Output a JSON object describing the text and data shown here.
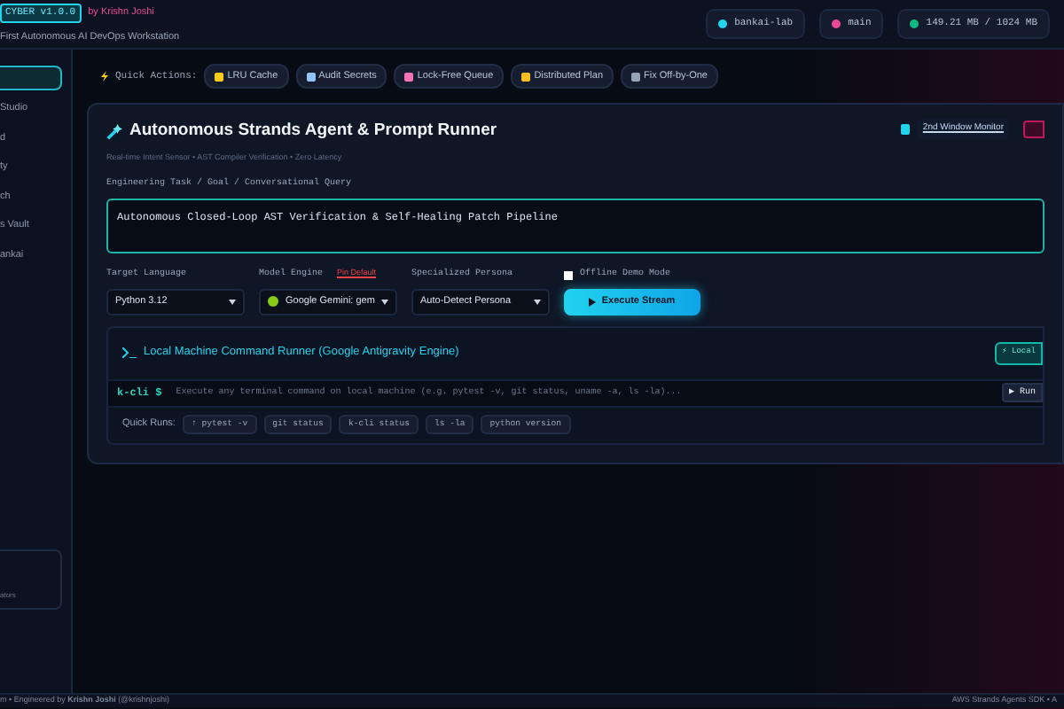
{
  "header": {
    "version": "CYBER v1.0.0",
    "byline": "by Krishn Joshi",
    "tagline": "First Autonomous AI DevOps Workstation",
    "chips": [
      {
        "kind": "host",
        "label": "bankai-lab"
      },
      {
        "kind": "branch",
        "label": "main"
      },
      {
        "kind": "memory",
        "label": "149.21 MB / 1024 MB"
      }
    ]
  },
  "sidebar": {
    "items": [
      {
        "selected": true
      },
      {
        "label": "Studio",
        "selected": false
      },
      {
        "label": "d",
        "selected": false
      },
      {
        "label": "ty",
        "selected": false
      },
      {
        "label": "ch",
        "selected": false
      },
      {
        "label": "s Vault",
        "selected": false
      },
      {
        "label": "ankai",
        "selected": false
      }
    ],
    "footer_note": "ators"
  },
  "quick_actions": {
    "label": "Quick Actions:",
    "items": [
      {
        "label": "LRU Cache"
      },
      {
        "label": "Audit Secrets"
      },
      {
        "label": "Lock-Free Queue"
      },
      {
        "label": "Distributed Plan"
      },
      {
        "label": "Fix Off-by-One"
      }
    ]
  },
  "runner": {
    "title": "Autonomous Strands Agent & Prompt Runner",
    "subtitle": "Real-time Intent Sensor • AST Compiler Verification • Zero Latency",
    "monitor_link": "2nd Window Monitor",
    "task_label": "Engineering Task / Goal / Conversational Query",
    "task_value": "Autonomous Closed-Loop AST Verification & Self-Healing Patch Pipeline",
    "language_label": "Target Language",
    "language": "Python 3.12",
    "model_label": "Model Engine",
    "pin_default": "Pin Default",
    "model": "Google Gemini: gem",
    "persona_label": "Specialized Persona",
    "persona": "Auto-Detect Persona",
    "offline_label": "Offline Demo Mode",
    "offline": false,
    "execute": "Execute Stream"
  },
  "terminal": {
    "title": "Local Machine Command Runner (Google Antigravity Engine)",
    "badge": "⚡ Local",
    "prompt": "k-cli $",
    "placeholder": "Execute any terminal command on local machine (e.g. pytest -v, git status, uname -a, ls -la)...",
    "run": "▶ Run",
    "quick_label": "Quick Runs:",
    "quick_runs": [
      "↑ pytest -v",
      "git status",
      "k-cli status",
      "ls -la",
      "python version"
    ]
  },
  "footer": {
    "left": "m • Engineered by **Krishn Joshi** (@krishnjoshi)",
    "right": "AWS Strands Agents SDK • A"
  }
}
